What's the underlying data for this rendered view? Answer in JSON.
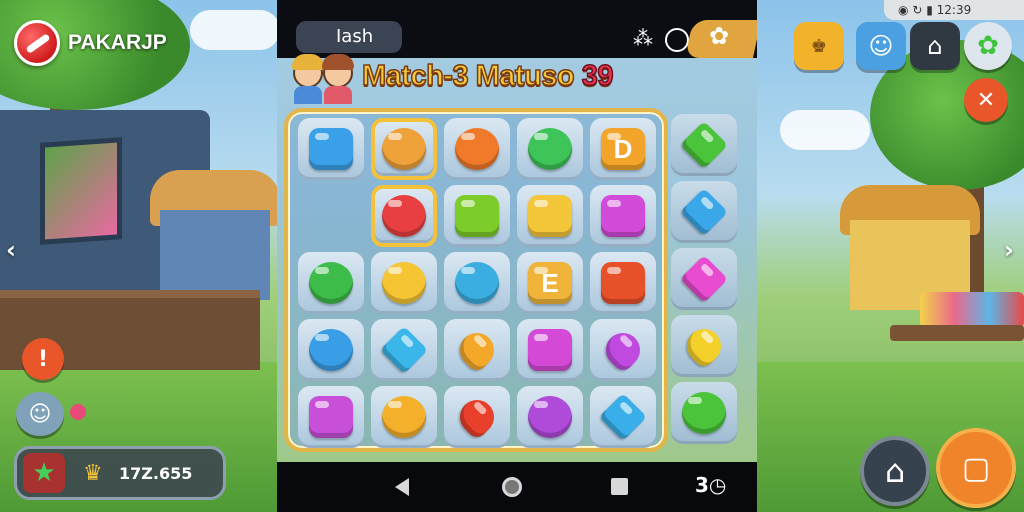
{
  "brand": {
    "name": "PAKARJP"
  },
  "phone": {
    "search_text": "Iash",
    "title": "Match-3 Matuso",
    "level": "39",
    "nav_extra": "3"
  },
  "right_status": {
    "time": "12:39"
  },
  "coins": {
    "value": "17Z.655"
  },
  "colors": {
    "brand_red": "#d01c1c",
    "board_border": "#e2b54a",
    "title_yellow": "#f5c93a",
    "level_red": "#e8334a"
  },
  "board": {
    "grid": [
      [
        {
          "color": "#3aa0e8",
          "shape": "square",
          "icon": ""
        },
        {
          "color": "#f0a23a",
          "shape": "round",
          "icon": "flower-gem"
        },
        {
          "color": "#f07a2a",
          "shape": "round",
          "icon": "sun-gem"
        },
        {
          "color": "#3ec458",
          "shape": "round",
          "icon": "star-gem"
        },
        {
          "color": "#f2a52a",
          "shape": "square",
          "icon": "letter-d-gem",
          "text": "D"
        }
      ],
      [
        {
          "color": "",
          "shape": "empty",
          "icon": ""
        },
        {
          "color": "#e84040",
          "shape": "round",
          "icon": "flower-gem"
        },
        {
          "color": "#7ccc2a",
          "shape": "square",
          "icon": "square-gem"
        },
        {
          "color": "#f4c63a",
          "shape": "square",
          "icon": "dice-gem"
        },
        {
          "color": "#d24ad8",
          "shape": "square",
          "icon": "swirl-gem"
        }
      ],
      [
        {
          "color": "#3ebc4a",
          "shape": "round",
          "icon": "leaf-gem"
        },
        {
          "color": "#f6c534",
          "shape": "round",
          "icon": "star-gem"
        },
        {
          "color": "#3aaee0",
          "shape": "round",
          "icon": "bubble-gem"
        },
        {
          "color": "#f0b43a",
          "shape": "square",
          "icon": "letter-e-gem",
          "text": "E"
        },
        {
          "color": "#e8502a",
          "shape": "square",
          "icon": "ring-gem"
        }
      ],
      [
        {
          "color": "#3a9ee6",
          "shape": "round",
          "icon": "drop-gem"
        },
        {
          "color": "#3ab6ea",
          "shape": "diamond",
          "icon": "diamond-gem"
        },
        {
          "color": "#f4a82a",
          "shape": "heart",
          "icon": "heart-gem"
        },
        {
          "color": "#d44ad6",
          "shape": "square",
          "icon": "ring-gem"
        },
        {
          "color": "#c04ae0",
          "shape": "heart",
          "icon": "heart-gem"
        }
      ],
      [
        {
          "color": "#c850d8",
          "shape": "square",
          "icon": "ring-gem"
        },
        {
          "color": "#f4b02a",
          "shape": "round",
          "icon": "flower-gem"
        },
        {
          "color": "#e8402a",
          "shape": "heart",
          "icon": "heart-gem"
        },
        {
          "color": "#b04ad8",
          "shape": "round",
          "icon": "berry-gem"
        },
        {
          "color": "#3aaee8",
          "shape": "diamond",
          "icon": "diamond-gem"
        }
      ]
    ],
    "side_column": [
      {
        "color": "#4ac43a",
        "shape": "diamond",
        "icon": "leaf-gem"
      },
      {
        "color": "#3aa8e8",
        "shape": "diamond",
        "icon": "diamond-gem"
      },
      {
        "color": "#e84ad0",
        "shape": "diamond",
        "icon": "gem-gem"
      },
      {
        "color": "#f4d02a",
        "shape": "heart",
        "icon": "heart-gem"
      },
      {
        "color": "#4ac43a",
        "shape": "round",
        "icon": "star-gem"
      }
    ]
  }
}
